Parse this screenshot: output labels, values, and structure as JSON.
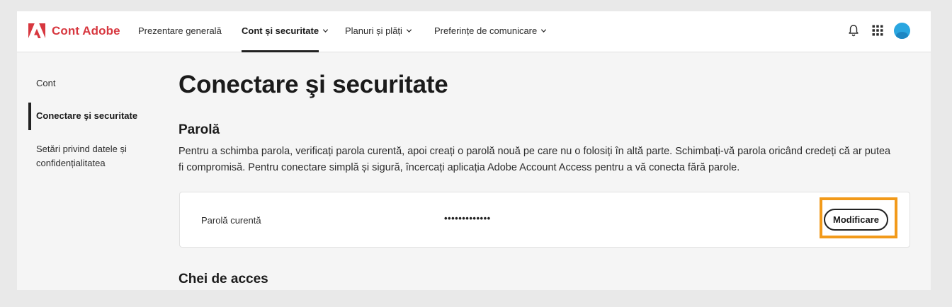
{
  "header": {
    "brand": "Cont Adobe",
    "nav": [
      {
        "label": "Prezentare generală"
      },
      {
        "label": "Cont și securitate"
      },
      {
        "label": "Planuri și plăți"
      },
      {
        "label": "Preferințe de comunicare"
      }
    ],
    "icons": [
      "bell-icon",
      "apps-grid-icon",
      "avatar"
    ]
  },
  "sidebar": {
    "items": [
      {
        "label": "Cont"
      },
      {
        "label": "Conectare şi securitate"
      },
      {
        "label": "Setări privind datele și"
      },
      {
        "label": "confidențialitatea"
      }
    ]
  },
  "main": {
    "title": "Conectare şi securitate",
    "password_section": {
      "title": "Parolă",
      "description": "Pentru a schimba parola, verificați parola curentă, apoi creați o parolă nouă pe care nu o folosiți în altă parte. Schimbați-vă parola oricând credeți că ar putea fi compromisă. Pentru conectare simplă și sigură, încercați aplicația Adobe Account Access pentru a vă conecta fără parole.",
      "current_label": "Parolă curentă",
      "current_value": "•••••••••••••",
      "modify_label": "Modificare"
    },
    "passkeys_title": "Chei de acces"
  },
  "colors": {
    "brand": "#d7373f",
    "highlight": "#f29a1a",
    "avatar": "#2aa6e0"
  }
}
